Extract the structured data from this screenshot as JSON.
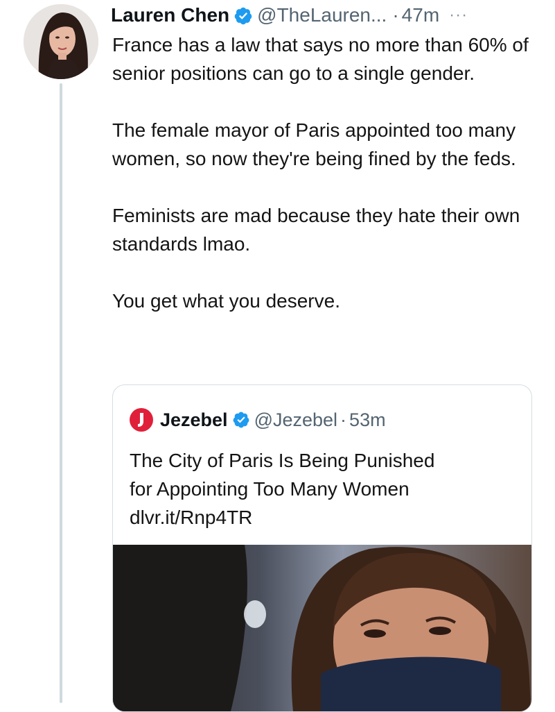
{
  "tweet": {
    "author_name": "Lauren Chen",
    "handle": "@TheLauren...",
    "separator": "·",
    "time": "47m",
    "more_icon": "···",
    "paragraphs": [
      "France has a law that says no more than 60% of senior positions can go to a single gender.",
      "The female mayor of Paris appointed too many women, so now they're being fined by the feds.",
      "Feminists are mad because they hate their own standards lmao.",
      "You get what you deserve."
    ]
  },
  "quoted_tweet": {
    "author_name": "Jezebel",
    "handle": "@Jezebel",
    "separator": "·",
    "time": "53m",
    "text_lines": [
      "The City of Paris Is Being Punished",
      "for Appointing Too Many Women",
      "dlvr.it/Rnp4TR"
    ]
  },
  "colors": {
    "verified_badge": "#1d9bf0",
    "jezebel_logo": "#e0203a",
    "thread_line": "#cfd9de",
    "secondary_text": "#536471"
  },
  "icons": {
    "verified": "verified-badge-icon",
    "more": "more-options-icon",
    "jezebel_logo": "jezebel-logo-icon"
  }
}
